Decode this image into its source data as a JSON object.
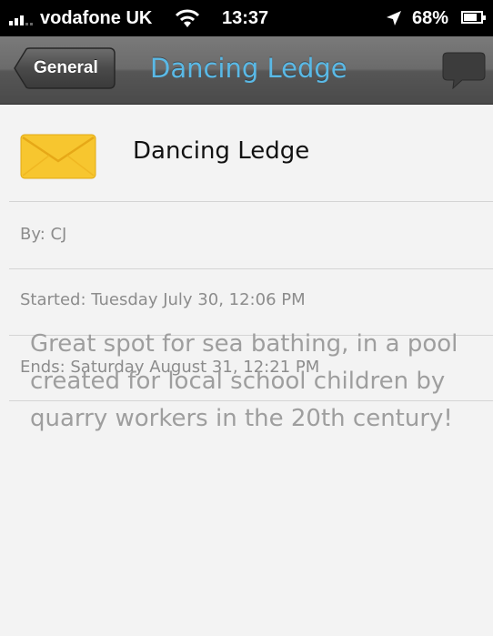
{
  "status_bar": {
    "carrier": "vodafone UK",
    "time": "13:37",
    "battery": "68%"
  },
  "nav": {
    "back_label": "General",
    "title": "Dancing Ledge",
    "right_icon": "speech-bubble-icon"
  },
  "post": {
    "icon": "envelope-icon",
    "title": "Dancing Ledge",
    "author": "By: CJ",
    "started": "Started: Tuesday July 30, 12:06 PM",
    "ends": "Ends: Saturday August 31, 12:21 PM",
    "description": "Great spot for sea bathing, in a pool created for local school children by quarry workers in the 20th century!"
  },
  "colors": {
    "title_accent": "#5ab9e6",
    "envelope": "#f7c62f",
    "secondary_text": "#8c8c8c"
  }
}
